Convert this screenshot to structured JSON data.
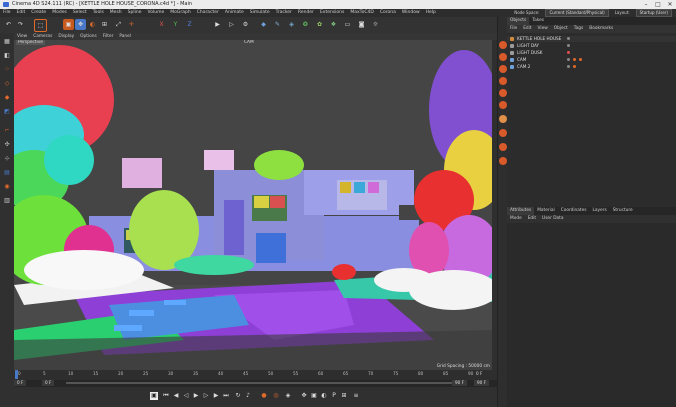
{
  "window": {
    "title": "Cinema 4D S24.111 (RC) - [KETTLE HOLE HOUSE_CORONA.c4d *] - Main"
  },
  "menu": [
    "File",
    "Edit",
    "Create",
    "Modes",
    "Select",
    "Tools",
    "Mesh",
    "Spline",
    "Volume",
    "MoGraph",
    "Character",
    "Animate",
    "Simulate",
    "Tracker",
    "Render",
    "Extensions",
    "MaxToC4D",
    "Corona",
    "Window",
    "Help"
  ],
  "menu_right": {
    "node_spaces_label": "Node Space:",
    "node_space_value": "Current (Standard/Physical)",
    "layout_label": "Layout:",
    "layout_value": "Startup (User)"
  },
  "viewport": {
    "menu": [
      "View",
      "Cameras",
      "Display",
      "Options",
      "Filter",
      "Panel"
    ],
    "projection": "Perspective",
    "camera": "CAM",
    "grid_spacing": "Grid Spacing : 50000 cm"
  },
  "timeline": {
    "ticks": [
      "0",
      "5",
      "10",
      "15",
      "20",
      "25",
      "30",
      "35",
      "40",
      "45",
      "50",
      "55",
      "60",
      "65",
      "70",
      "75",
      "80",
      "85",
      "90"
    ],
    "current": "0 F"
  },
  "range": {
    "start": "0 F",
    "start2": "0 F",
    "end": "90 F",
    "end2": "90 F"
  },
  "objects_panel": {
    "tabs": [
      "Objects",
      "Takes"
    ],
    "menu": [
      "File",
      "Edit",
      "View",
      "Object",
      "Tags",
      "Bookmarks"
    ],
    "items": [
      {
        "name": "KETTLE HOLE HOUSE",
        "color": "#d08a3c"
      },
      {
        "name": "LIGHT DAY",
        "color": "#9b9b9b"
      },
      {
        "name": "LIGHT DUSK",
        "color": "#9b9b9b"
      },
      {
        "name": "CAM",
        "color": "#6fa0d8"
      },
      {
        "name": "CAM.2",
        "color": "#6fa0d8"
      }
    ]
  },
  "attributes_panel": {
    "tabs": [
      "Attributes",
      "Material",
      "Coordinates",
      "Layers",
      "Structure"
    ],
    "menu": [
      "Mode",
      "Edit",
      "User Data"
    ]
  },
  "icons": {
    "undo": "undo-icon",
    "redo": "redo-icon",
    "move": "move-icon",
    "scale": "scale-icon",
    "rotate": "rotate-icon",
    "render": "render-icon",
    "camera": "camera-icon"
  },
  "colors": {
    "accent": "#e06a2a",
    "select_blue": "#4a78c8",
    "viewport_bg": "#424242"
  }
}
